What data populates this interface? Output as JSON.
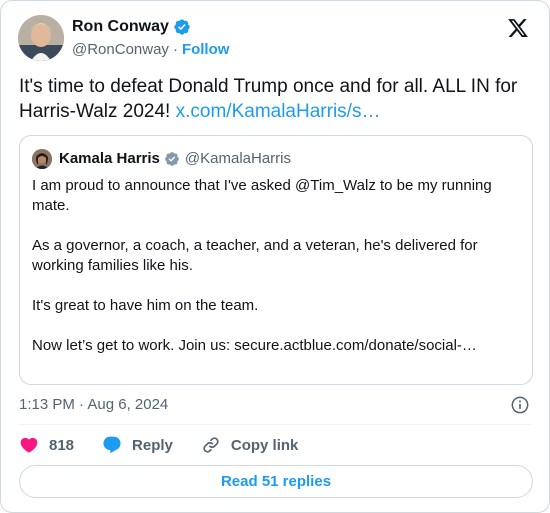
{
  "author": {
    "name": "Ron Conway",
    "handle": "@RonConway",
    "separator": "·",
    "follow_label": "Follow"
  },
  "tweet": {
    "text": "It's time to defeat Donald Trump once and for all. ALL IN for Harris-Walz 2024! ",
    "link": "x.com/KamalaHarris/s…"
  },
  "quoted": {
    "name": "Kamala Harris",
    "handle": "@KamalaHarris",
    "paragraphs": [
      "I am proud to announce that I've asked @Tim_Walz to be my running mate.",
      "As a governor, a coach, a teacher, and a veteran, he's delivered for working families like his.",
      "It's great to have him on the team.",
      "Now let’s get to work. Join us: secure.actblue.com/donate/social-…"
    ]
  },
  "timestamp": "1:13 PM · Aug 6, 2024",
  "actions": {
    "like_count": "818",
    "reply_label": "Reply",
    "copy_label": "Copy link"
  },
  "read_replies_label": "Read 51 replies",
  "colors": {
    "accent": "#1d9bf0",
    "like": "#f91880",
    "text": "#0f1419",
    "secondary": "#536471",
    "border": "#cfd9de"
  },
  "icons": [
    "verified-badge-icon",
    "x-logo-icon",
    "info-icon",
    "heart-icon",
    "reply-bubble-icon",
    "link-icon"
  ]
}
